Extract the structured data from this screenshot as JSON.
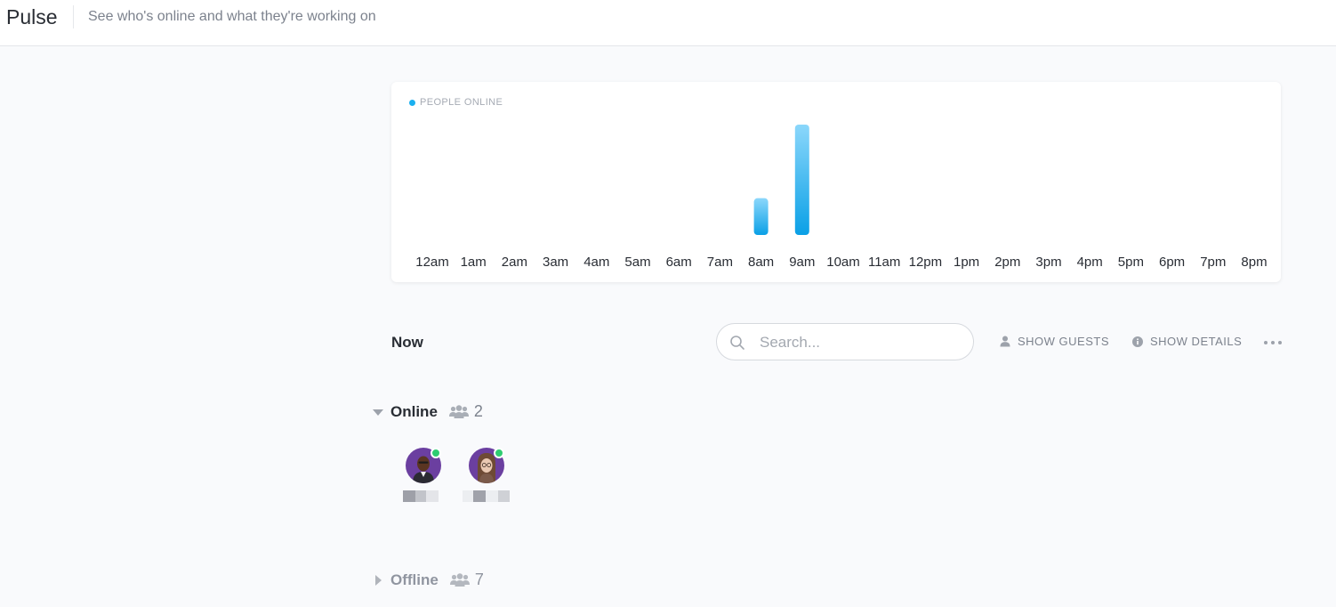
{
  "header": {
    "app_title": "Pulse",
    "subtitle": "See who's online and what they're working on"
  },
  "chart_data": {
    "type": "bar",
    "title": "PEOPLE ONLINE",
    "categories": [
      "12am",
      "1am",
      "2am",
      "3am",
      "4am",
      "5am",
      "6am",
      "7am",
      "8am",
      "9am",
      "10am",
      "11am",
      "12pm",
      "1pm",
      "2pm",
      "3pm",
      "4pm",
      "5pm",
      "6pm",
      "7pm",
      "8pm"
    ],
    "values": [
      0,
      0,
      0,
      0,
      0,
      0,
      0,
      0,
      1,
      3,
      0,
      0,
      0,
      0,
      0,
      0,
      0,
      0,
      0,
      0,
      0
    ],
    "ylim": [
      0,
      3
    ],
    "grid": false,
    "legend": "top-left",
    "colors": {
      "legend_dot": "#1ab0f0",
      "bar_top": "#8bd7fb",
      "bar_bottom": "#0aa0e6"
    }
  },
  "now": {
    "label": "Now"
  },
  "search": {
    "placeholder": "Search...",
    "value": ""
  },
  "toolbar": {
    "show_guests_label": "SHOW GUESTS",
    "show_details_label": "SHOW DETAILS",
    "more_icon": "ellipsis-icon"
  },
  "groups": {
    "online": {
      "label": "Online",
      "count": "2",
      "expanded": true,
      "status_color": "#2ecc71",
      "members": [
        {
          "avatar_color": "#6b3fa0"
        },
        {
          "avatar_color": "#6b3fa0"
        }
      ]
    },
    "offline": {
      "label": "Offline",
      "count": "7",
      "expanded": false
    }
  }
}
